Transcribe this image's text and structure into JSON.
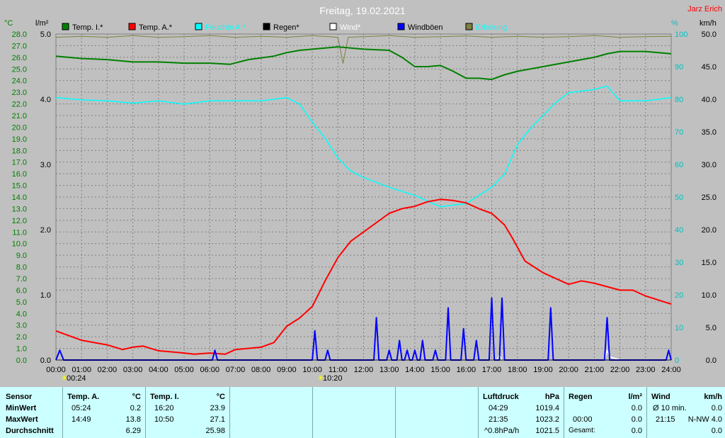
{
  "title": "Freitag, 19.02.2021",
  "author": "Jarz Erich",
  "units": {
    "temp": "°C",
    "rain": "l/m²",
    "hum": "%",
    "wind": "km/h"
  },
  "legend": [
    {
      "name": "Temp. I.*",
      "color": "#008000"
    },
    {
      "name": "Temp. A.*",
      "color": "#ff0000"
    },
    {
      "name": "Feuchte A.*",
      "color": "#00ffff"
    },
    {
      "name": "Regen*",
      "color": "#000000"
    },
    {
      "name": "Wind*",
      "color": "#ffffff"
    },
    {
      "name": "Windböen",
      "color": "#0000ff"
    },
    {
      "name": "Erholung",
      "color": "#808040"
    }
  ],
  "markers": [
    "00:24",
    "10:20"
  ],
  "chart_data": {
    "type": "line",
    "title": "Freitag, 19.02.2021",
    "x_range": [
      0,
      24
    ],
    "x_ticks": [
      "00:00",
      "01:00",
      "02:00",
      "03:00",
      "04:00",
      "05:00",
      "06:00",
      "07:00",
      "08:00",
      "09:00",
      "10:00",
      "11:00",
      "12:00",
      "13:00",
      "14:00",
      "15:00",
      "16:00",
      "17:00",
      "18:00",
      "19:00",
      "20:00",
      "21:00",
      "22:00",
      "23:00",
      "24:00"
    ],
    "axes": {
      "temp": {
        "label": "°C",
        "range": [
          0,
          28
        ],
        "ticks": [
          "0.0",
          "1.0",
          "2.0",
          "3.0",
          "4.0",
          "5.0",
          "6.0",
          "7.0",
          "8.0",
          "9.0",
          "10.0",
          "11.0",
          "12.0",
          "13.0",
          "14.0",
          "15.0",
          "16.0",
          "17.0",
          "18.0",
          "19.0",
          "20.0",
          "21.0",
          "22.0",
          "23.0",
          "24.0",
          "25.0",
          "26.0",
          "27.0",
          "28.0"
        ]
      },
      "rain": {
        "label": "l/m²",
        "range": [
          0,
          5
        ],
        "ticks": [
          "0.0",
          "1.0",
          "2.0",
          "3.0",
          "4.0",
          "5.0"
        ]
      },
      "hum": {
        "label": "%",
        "range": [
          0,
          100
        ],
        "ticks": [
          "0",
          "10",
          "20",
          "30",
          "40",
          "50",
          "60",
          "70",
          "80",
          "90",
          "100"
        ]
      },
      "wind": {
        "label": "km/h",
        "range": [
          0,
          50
        ],
        "ticks": [
          "0.0",
          "5.0",
          "10.0",
          "15.0",
          "20.0",
          "25.0",
          "30.0",
          "35.0",
          "40.0",
          "45.0",
          "50.0"
        ]
      }
    },
    "series": [
      {
        "name": "Temp. I.*",
        "axis": "temp",
        "color": "#008000",
        "points": [
          [
            0,
            26.1
          ],
          [
            1,
            25.9
          ],
          [
            2,
            25.8
          ],
          [
            3,
            25.6
          ],
          [
            4,
            25.6
          ],
          [
            5,
            25.5
          ],
          [
            6,
            25.5
          ],
          [
            6.8,
            25.4
          ],
          [
            7.5,
            25.8
          ],
          [
            8.5,
            26.1
          ],
          [
            9,
            26.4
          ],
          [
            9.5,
            26.6
          ],
          [
            10,
            26.7
          ],
          [
            11,
            26.9
          ],
          [
            12,
            26.7
          ],
          [
            13,
            26.6
          ],
          [
            13.5,
            26.0
          ],
          [
            14,
            25.2
          ],
          [
            14.5,
            25.2
          ],
          [
            15,
            25.3
          ],
          [
            15.5,
            24.8
          ],
          [
            16,
            24.2
          ],
          [
            16.5,
            24.2
          ],
          [
            17,
            24.1
          ],
          [
            17.5,
            24.5
          ],
          [
            18,
            24.8
          ],
          [
            19,
            25.2
          ],
          [
            20,
            25.6
          ],
          [
            21,
            26.0
          ],
          [
            21.5,
            26.3
          ],
          [
            22,
            26.5
          ],
          [
            23,
            26.5
          ],
          [
            24,
            26.3
          ]
        ]
      },
      {
        "name": "Temp. A.*",
        "axis": "temp",
        "color": "#ff0000",
        "points": [
          [
            0,
            2.5
          ],
          [
            1,
            1.7
          ],
          [
            2,
            1.3
          ],
          [
            2.6,
            0.9
          ],
          [
            3,
            1.1
          ],
          [
            3.4,
            1.2
          ],
          [
            4,
            0.8
          ],
          [
            5,
            0.6
          ],
          [
            5.4,
            0.5
          ],
          [
            6,
            0.6
          ],
          [
            6.6,
            0.5
          ],
          [
            7,
            0.9
          ],
          [
            8,
            1.1
          ],
          [
            8.5,
            1.5
          ],
          [
            9,
            2.9
          ],
          [
            9.5,
            3.6
          ],
          [
            10,
            4.6
          ],
          [
            10.5,
            6.8
          ],
          [
            11,
            8.8
          ],
          [
            11.5,
            10.2
          ],
          [
            12,
            11.0
          ],
          [
            13,
            12.6
          ],
          [
            13.5,
            13.0
          ],
          [
            14,
            13.2
          ],
          [
            14.5,
            13.6
          ],
          [
            15,
            13.8
          ],
          [
            15.5,
            13.7
          ],
          [
            16,
            13.5
          ],
          [
            16.5,
            13.0
          ],
          [
            17,
            12.6
          ],
          [
            17.5,
            11.6
          ],
          [
            17.8,
            10.5
          ],
          [
            18.3,
            8.5
          ],
          [
            19,
            7.5
          ],
          [
            20,
            6.5
          ],
          [
            20.5,
            6.8
          ],
          [
            21,
            6.6
          ],
          [
            21.5,
            6.3
          ],
          [
            22,
            6.0
          ],
          [
            22.5,
            6.0
          ],
          [
            23,
            5.5
          ],
          [
            24,
            4.8
          ]
        ]
      },
      {
        "name": "Feuchte A.*",
        "axis": "hum",
        "color": "#00ffff",
        "points": [
          [
            0,
            80.5
          ],
          [
            1,
            79.8
          ],
          [
            2,
            79.5
          ],
          [
            3,
            78.8
          ],
          [
            4,
            79.5
          ],
          [
            5,
            78.5
          ],
          [
            6,
            79.5
          ],
          [
            7,
            79.5
          ],
          [
            8,
            79.5
          ],
          [
            9,
            80.5
          ],
          [
            9.5,
            78.5
          ],
          [
            10,
            73
          ],
          [
            10.5,
            68
          ],
          [
            11,
            62
          ],
          [
            11.5,
            58
          ],
          [
            12,
            56
          ],
          [
            13,
            53
          ],
          [
            14,
            50.5
          ],
          [
            15,
            47
          ],
          [
            16,
            48
          ],
          [
            17,
            53
          ],
          [
            17.5,
            57
          ],
          [
            18,
            66
          ],
          [
            18.5,
            71
          ],
          [
            19,
            75
          ],
          [
            19.5,
            79
          ],
          [
            20,
            82
          ],
          [
            21,
            83
          ],
          [
            21.5,
            84
          ],
          [
            22,
            79.5
          ],
          [
            23,
            79.5
          ],
          [
            24,
            80.5
          ]
        ]
      },
      {
        "name": "Windböen",
        "axis": "wind",
        "color": "#0000ff",
        "points": [
          [
            0,
            0
          ],
          [
            0.15,
            1.5
          ],
          [
            0.3,
            0
          ],
          [
            6.1,
            0
          ],
          [
            6.2,
            1.5
          ],
          [
            6.3,
            0
          ],
          [
            10.0,
            0
          ],
          [
            10.1,
            4.5
          ],
          [
            10.2,
            0
          ],
          [
            10.5,
            0
          ],
          [
            10.6,
            1.5
          ],
          [
            10.7,
            0
          ],
          [
            12.4,
            0
          ],
          [
            12.5,
            6.5
          ],
          [
            12.6,
            0
          ],
          [
            12.9,
            0
          ],
          [
            13.0,
            1.5
          ],
          [
            13.1,
            0
          ],
          [
            13.3,
            0
          ],
          [
            13.4,
            3
          ],
          [
            13.5,
            0
          ],
          [
            13.6,
            0
          ],
          [
            13.7,
            1.5
          ],
          [
            13.8,
            0
          ],
          [
            13.9,
            0
          ],
          [
            14.0,
            1.5
          ],
          [
            14.1,
            0
          ],
          [
            14.2,
            0
          ],
          [
            14.3,
            3
          ],
          [
            14.4,
            0
          ],
          [
            14.7,
            0
          ],
          [
            14.8,
            1.5
          ],
          [
            14.9,
            0
          ],
          [
            15.2,
            0
          ],
          [
            15.3,
            8
          ],
          [
            15.4,
            0
          ],
          [
            15.8,
            0
          ],
          [
            15.9,
            4.8
          ],
          [
            16.0,
            0
          ],
          [
            16.3,
            0
          ],
          [
            16.4,
            3
          ],
          [
            16.5,
            0
          ],
          [
            16.9,
            0
          ],
          [
            17.0,
            9.5
          ],
          [
            17.1,
            0
          ],
          [
            17.3,
            0
          ],
          [
            17.4,
            9.5
          ],
          [
            17.5,
            0
          ],
          [
            19.2,
            0
          ],
          [
            19.3,
            8
          ],
          [
            19.4,
            0
          ],
          [
            21.4,
            0
          ],
          [
            21.5,
            6.5
          ],
          [
            21.6,
            0
          ],
          [
            23.8,
            0
          ],
          [
            23.9,
            1.5
          ],
          [
            24,
            0
          ]
        ]
      },
      {
        "name": "Wind*",
        "axis": "wind",
        "color": "#ffffff",
        "points": [
          [
            0,
            0
          ],
          [
            17.2,
            0
          ],
          [
            17.3,
            0.8
          ],
          [
            17.4,
            0
          ],
          [
            21.4,
            0
          ],
          [
            21.5,
            1.5
          ],
          [
            21.6,
            0.5
          ],
          [
            22,
            0
          ],
          [
            24,
            0
          ]
        ]
      },
      {
        "name": "Erholung",
        "axis": "hum",
        "color": "#808040",
        "points": [
          [
            0,
            99
          ],
          [
            1,
            99.3
          ],
          [
            2,
            99
          ],
          [
            3,
            99.5
          ],
          [
            4,
            99
          ],
          [
            5,
            99.2
          ],
          [
            6,
            99.5
          ],
          [
            7,
            99
          ],
          [
            8,
            99.3
          ],
          [
            9,
            99
          ],
          [
            10,
            99.5
          ],
          [
            11,
            99
          ],
          [
            11.2,
            91
          ],
          [
            11.4,
            99
          ],
          [
            12,
            99.2
          ],
          [
            13,
            99.5
          ],
          [
            14,
            99
          ],
          [
            15,
            99.2
          ],
          [
            16,
            99.4
          ],
          [
            17,
            99
          ],
          [
            18,
            99.3
          ],
          [
            19,
            99
          ],
          [
            20,
            99.2
          ],
          [
            21,
            99.5
          ],
          [
            22,
            99
          ],
          [
            23,
            99.2
          ],
          [
            24,
            99.3
          ]
        ]
      }
    ]
  },
  "panel": {
    "sensor": {
      "header": "Sensor",
      "min": "MinWert",
      "max": "MaxWert",
      "avg": "Durchschnitt"
    },
    "temp_a": {
      "header": "Temp. A.",
      "unit": "°C",
      "min_time": "05:24",
      "min_val": "0.2",
      "max_time": "14:49",
      "max_val": "13.8",
      "avg": "6.29"
    },
    "temp_i": {
      "header": "Temp. I.",
      "unit": "°C",
      "min_time": "16:20",
      "min_val": "23.9",
      "max_time": "10:50",
      "max_val": "27.1",
      "avg": "25.98"
    },
    "pressure": {
      "header": "Luftdruck",
      "unit": "hPa",
      "min_time": "04:29",
      "min_val": "1019.4",
      "max_time": "21:35",
      "max_val": "1023.2",
      "trend": "^0.8hPa/h",
      "avg": "1021.5"
    },
    "rain": {
      "header": "Regen",
      "unit": "l/m²",
      "max_time": "00:00",
      "max_val": "0.0",
      "total_label": "Gesamt:",
      "total_val": "0.0",
      "min_val": "0.0"
    },
    "wind": {
      "header": "Wind",
      "unit": "km/h",
      "avg_label": "Ø 10 min.",
      "avg_val": "0.0",
      "max_time": "21:15",
      "max_val": "N-NW 4.0",
      "last": "0.0"
    }
  }
}
